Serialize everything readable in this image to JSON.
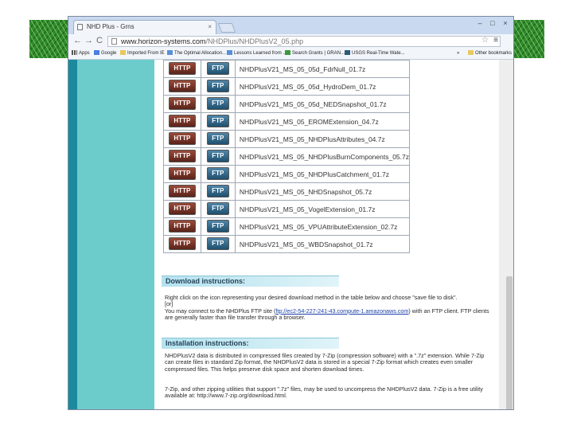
{
  "browser": {
    "tab_title": "NHD Plus - Grns",
    "tab_close": "×",
    "window_buttons": [
      "–",
      "□",
      "×"
    ],
    "url_domain": "www.horizon-systems.com",
    "url_path": "/NHDPlus/NHDPlusV2_05.php",
    "nav_icons": [
      "back-arrow-icon",
      "forward-arrow-icon",
      "reload-icon"
    ],
    "nav_glyphs": [
      "←",
      "→",
      "C"
    ],
    "star_glyph": "☆",
    "menu_glyph": "≡"
  },
  "bookmarks": [
    {
      "label": "Apps",
      "icon": "apps-icon"
    },
    {
      "label": "Google",
      "icon": "google-icon"
    },
    {
      "label": "Imported From IE",
      "icon": "folder-icon"
    },
    {
      "label": "The Optimal Allocation...",
      "icon": "doc-icon"
    },
    {
      "label": "Lessons Learned from ...",
      "icon": "doc-icon"
    },
    {
      "label": "Search Grants | GRAN...",
      "icon": "check-icon"
    },
    {
      "label": "USGS Real-Time Wate...",
      "icon": "usgs-icon"
    },
    {
      "label": "Other bookmarks",
      "icon": "folder-icon"
    }
  ],
  "bookmarks_more": "»",
  "files": [
    {
      "http": "HTTP",
      "ftp": "FTP",
      "name": "NHDPlusV21_MS_05_05d_FdrNull_01.7z"
    },
    {
      "http": "HTTP",
      "ftp": "FTP",
      "name": "NHDPlusV21_MS_05_05d_HydroDem_01.7z"
    },
    {
      "http": "HTTP",
      "ftp": "FTP",
      "name": "NHDPlusV21_MS_05_05d_NEDSnapshot_01.7z"
    },
    {
      "http": "HTTP",
      "ftp": "FTP",
      "name": "NHDPlusV21_MS_05_EROMExtension_04.7z"
    },
    {
      "http": "HTTP",
      "ftp": "FTP",
      "name": "NHDPlusV21_MS_05_NHDPlusAttributes_04.7z"
    },
    {
      "http": "HTTP",
      "ftp": "FTP",
      "name": "NHDPlusV21_MS_05_NHDPlusBurnComponents_05.7z"
    },
    {
      "http": "HTTP",
      "ftp": "FTP",
      "name": "NHDPlusV21_MS_05_NHDPlusCatchment_01.7z"
    },
    {
      "http": "HTTP",
      "ftp": "FTP",
      "name": "NHDPlusV21_MS_05_NHDSnapshot_05.7z"
    },
    {
      "http": "HTTP",
      "ftp": "FTP",
      "name": "NHDPlusV21_MS_05_VogelExtension_01.7z"
    },
    {
      "http": "HTTP",
      "ftp": "FTP",
      "name": "NHDPlusV21_MS_05_VPUAttributeExtension_02.7z"
    },
    {
      "http": "HTTP",
      "ftp": "FTP",
      "name": "NHDPlusV21_MS_05_WBDSnapshot_01.7z"
    }
  ],
  "download": {
    "header": "Download instructions:",
    "line1": "Right click on the icon representing your desired download method in the table below and choose \"save file to disk\".",
    "or": "[or]",
    "line2_pre": "You may connect to the NHDPlus FTP site (",
    "line2_link": "ftp://ec2-54-227-241-43.compute-1.amazonaws.com",
    "line2_post": ") with an FTP client. FTP clients are generally faster than file transfer through a browser."
  },
  "installation": {
    "header": "Installation instructions:",
    "para1": "NHDPlusV2 data is distributed in compressed files created by 7-Zip (compression software) with a \".7z\" extension. While 7-Zip can create files in standard Zip format, the NHDPlusV2 data is stored in a special 7-Zip format which creates even smaller compressed files. This helps preserve disk space and shorten download times.",
    "para2": "7-Zip, and other zipping utilities that support \".7z\" files, may be used to uncompress the NHDPlusV2 data. 7-Zip is a free utility available at: http://www.7-zip.org/download.html."
  },
  "colors": {
    "page_teal": "#6ccccc",
    "page_dark_teal": "#1c8a9d",
    "http_button": "#7a3426",
    "ftp_button": "#2f6688",
    "section_header": "#b4e2ee"
  }
}
